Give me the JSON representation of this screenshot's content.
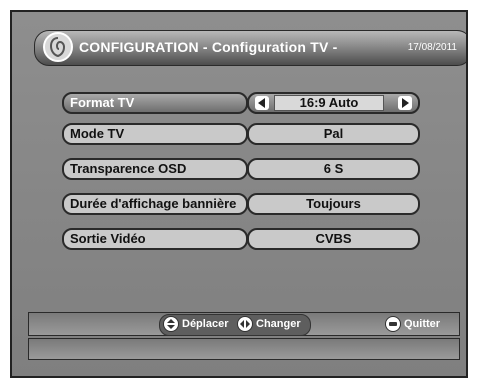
{
  "header": {
    "title": "CONFIGURATION - Configuration TV -",
    "date": "17/08/2011",
    "logo_icon": "tv-channel-logo-icon"
  },
  "settings": [
    {
      "label": "Format TV",
      "value": "16:9 Auto",
      "selected": true
    },
    {
      "label": "Mode TV",
      "value": "Pal"
    },
    {
      "label": "Transparence OSD",
      "value": "6 S"
    },
    {
      "label": "Durée d'affichage bannière",
      "value": "Toujours"
    },
    {
      "label": "Sortie Vidéo",
      "value": "CVBS"
    }
  ],
  "footer": {
    "move_label": "Déplacer",
    "change_label": "Changer",
    "quit_label": "Quitter"
  },
  "colors": {
    "background": "#8a8a8a",
    "pill": "#c9c9c9",
    "selected": "#7a7a7a",
    "text_light": "#ffffff",
    "text_dark": "#111111"
  }
}
